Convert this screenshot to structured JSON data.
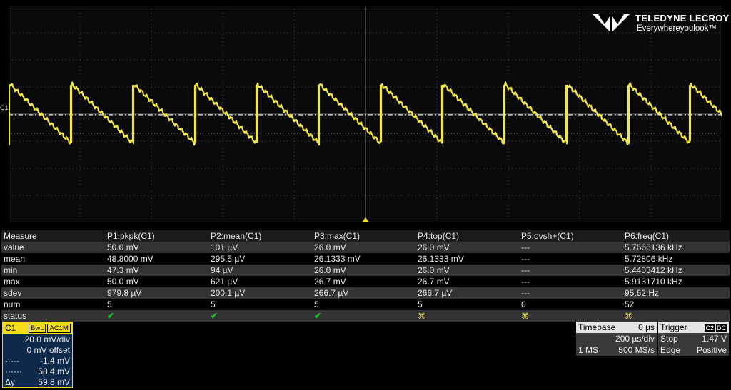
{
  "logo": {
    "brand": "TELEDYNE LECROY",
    "tagline": "Everywhereyoulook™"
  },
  "trace": {
    "channel_marker": "C1",
    "color": "#f2e64a"
  },
  "measure": {
    "header": [
      "Measure",
      "P1:pkpk(C1)",
      "P2:mean(C1)",
      "P3:max(C1)",
      "P4:top(C1)",
      "P5:ovsh+(C1)",
      "P6:freq(C1)"
    ],
    "rows": [
      {
        "label": "value",
        "cells": [
          "50.0 mV",
          "101 µV",
          "26.0 mV",
          "26.0 mV",
          "---",
          "5.7666136 kHz"
        ]
      },
      {
        "label": "mean",
        "cells": [
          "48.8000 mV",
          "295.5 µV",
          "26.1333 mV",
          "26.1333 mV",
          "---",
          "5.72806 kHz"
        ]
      },
      {
        "label": "min",
        "cells": [
          "47.3 mV",
          "94 µV",
          "26.0 mV",
          "26.0 mV",
          "---",
          "5.4403412 kHz"
        ]
      },
      {
        "label": "max",
        "cells": [
          "50.0 mV",
          "621 µV",
          "26.7 mV",
          "26.7 mV",
          "---",
          "5.9131710 kHz"
        ]
      },
      {
        "label": "sdev",
        "cells": [
          "979.8 µV",
          "200.1 µV",
          "266.7 µV",
          "266.7 µV",
          "---",
          "95.62 Hz"
        ]
      },
      {
        "label": "num",
        "cells": [
          "5",
          "5",
          "5",
          "5",
          "0",
          "52"
        ]
      }
    ],
    "status_label": "status",
    "status": [
      "ok",
      "ok",
      "ok",
      "warn",
      "warn",
      "warn"
    ]
  },
  "c1": {
    "label": "C1",
    "tag1": "BwL",
    "tag2": "AC1M",
    "vdiv": "20.0 mV/div",
    "offset": "0 mV offset",
    "cursor1_sym": "-·-·-",
    "cursor1": "-1.4 mV",
    "cursor2_sym": "······",
    "cursor2": "58.4 mV",
    "dy_sym": "Δy",
    "dy": "59.8 mV"
  },
  "timebase": {
    "title": "Timebase",
    "delay": "0 µs",
    "tdiv": "200 µs/div",
    "points": "1 MS",
    "rate": "500 MS/s"
  },
  "trigger": {
    "title": "Trigger",
    "src": "C2",
    "coupling": "DC",
    "mode": "Stop",
    "level": "1.47 V",
    "type": "Edge",
    "slope": "Positive"
  }
}
